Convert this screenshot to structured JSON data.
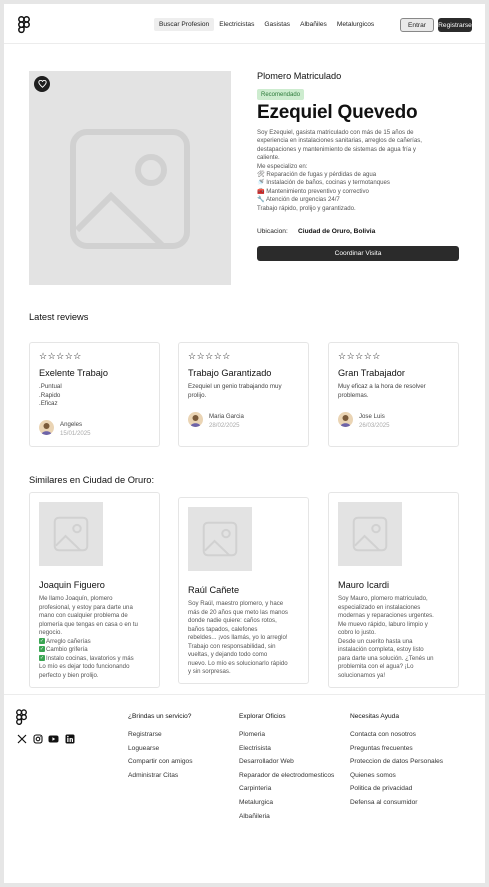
{
  "header": {
    "nav": [
      "Buscar Profesion",
      "Electricistas",
      "Gasistas",
      "Albañiles",
      "Metalurgicos"
    ],
    "login_label": "Entrar",
    "register_label": "Registrarse"
  },
  "profile": {
    "profession": "Plomero Matriculado",
    "badge": "Recomendado",
    "name": "Ezequiel Quevedo",
    "description": [
      "Soy Ezequiel, gasista matriculado con más de 15 años de",
      "experiencia en instalaciones sanitarias, arreglos de cañerías,",
      "destapaciones y mantenimiento de sistemas de agua fría y",
      "caliente.",
      "Me especializo en:",
      "🛠 Reparación de fugas y pérdidas de agua",
      "🚿 Instalación de baños, cocinas y termotanques",
      "🧰 Mantenimiento preventivo y correctivo",
      "🔧 Atención de urgencias 24/7",
      "Trabajo rápido, prolijo y garantizado."
    ],
    "location_label": "Ubicacion:",
    "location_value": "Ciudad de Oruro, Bolivia",
    "contact_button": "Coordinar Visita"
  },
  "reviews_section": {
    "title": "Latest reviews",
    "stars": "☆☆☆☆☆",
    "items": [
      {
        "title": "Exelente Trabajo",
        "text": [
          ".Puntual",
          ".Rapido",
          ".Eficaz"
        ],
        "author": "Angeles",
        "date": "15/01/2025"
      },
      {
        "title": "Trabajo Garantizado",
        "text": [
          "Ezequiel un genio trabajando muy",
          "prolijo."
        ],
        "author": "Maria Garcia",
        "date": "28/02/2025"
      },
      {
        "title": "Gran Trabajador",
        "text": [
          "Muy eficaz a la hora de resolver",
          "problemas."
        ],
        "author": "Jose Luis",
        "date": "26/03/2025"
      }
    ]
  },
  "similar_section": {
    "title": "Similares en Ciudad de Oruro:",
    "items": [
      {
        "name": "Joaquin Figuero",
        "text": [
          "Me llamo Joaquín, plomero",
          "profesional, y estoy para darte una",
          "mano con cualquier problema de",
          "plomería que tengas en casa o en tu",
          "negocio.",
          "Arreglo cañerías",
          "Cambio grifería",
          "Instalo cocinas, lavatorios y más",
          "Lo mío es dejar todo funcionando",
          "perfecto y bien prolijo."
        ]
      },
      {
        "name": "Raúl Cañete",
        "text": [
          "Soy Raúl, maestro plomero, y hace",
          "más de 20 años que meto las manos",
          "donde nadie quiere: caños rotos,",
          "baños tapados, calefones",
          "rebeldes... ¡vos llamás, yo lo arreglo!",
          " Trabajo con responsabilidad, sin",
          "vueltas, y dejando todo como",
          "nuevo. Lo mío es solucionarlo rápido",
          "y sin sorpresas."
        ]
      },
      {
        "name": "Mauro Icardi",
        "text": [
          "Soy Mauro, plomero matriculado,",
          "especializado en instalaciones",
          "modernas y reparaciones urgentes.",
          " Me muevo rápido, laburo limpio y",
          "cobro lo justo.",
          " Desde un cuerito hasta una",
          "instalación completa, estoy listo",
          "para darte una solución. ¿Tenés un",
          "problemita con el agua? ¡Lo",
          "solucionamos ya!"
        ]
      }
    ]
  },
  "footer": {
    "columns": [
      {
        "title": "¿Brindas un servicio?",
        "links": [
          "Registrarse",
          "Loguearse",
          "Compartir con amigos",
          "Administrar Citas"
        ]
      },
      {
        "title": "Explorar Oficios",
        "links": [
          "Plomeria",
          "Electrisista",
          "Desarrollador Web",
          "Reparador de electrodomesticos",
          "Carpinteria",
          "Metalurgica",
          "Albañileria"
        ]
      },
      {
        "title": "Necesitas Ayuda",
        "links": [
          "Contacta con nosotros",
          "Preguntas frecuentes",
          "Proteccion de datos Personales",
          "Quienes somos",
          "Politica de privacidad",
          "Defensa al consumidor"
        ]
      }
    ],
    "socials": [
      "x-icon",
      "instagram-icon",
      "youtube-icon",
      "linkedin-icon"
    ]
  }
}
